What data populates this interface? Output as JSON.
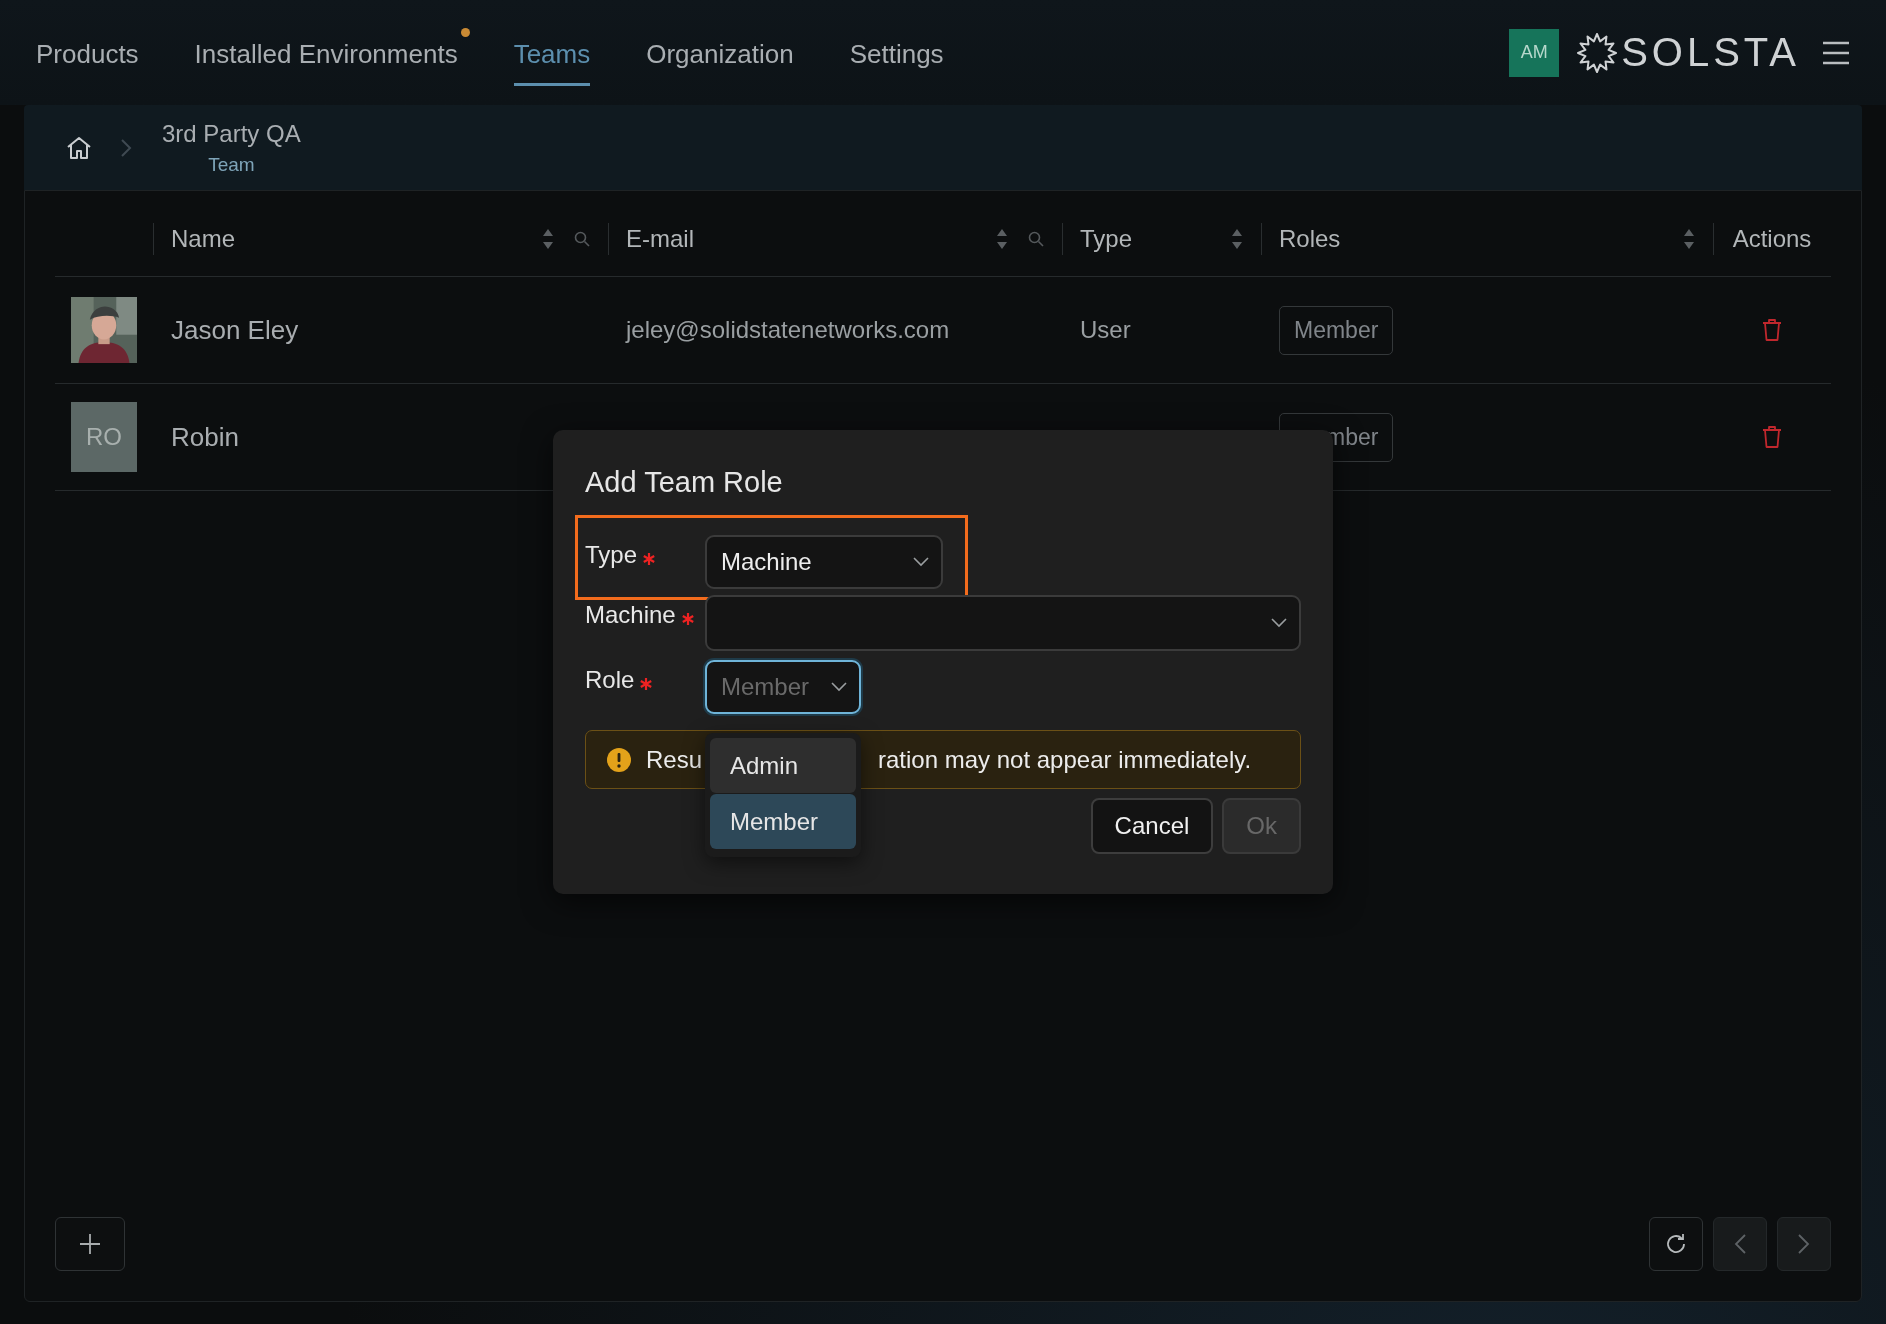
{
  "nav": {
    "tabs": [
      {
        "label": "Products",
        "selected": false,
        "badge": false
      },
      {
        "label": "Installed Environments",
        "selected": false,
        "badge": true
      },
      {
        "label": "Teams",
        "selected": true,
        "badge": false
      },
      {
        "label": "Organization",
        "selected": false,
        "badge": false
      },
      {
        "label": "Settings",
        "selected": false,
        "badge": false
      }
    ],
    "user_initials": "AM",
    "logo": "SOLSTA"
  },
  "breadcrumb": {
    "title": "3rd Party QA",
    "subtitle": "Team"
  },
  "table": {
    "columns": [
      {
        "label": "Name",
        "sortable": true,
        "searchable": true
      },
      {
        "label": "E-mail",
        "sortable": true,
        "searchable": true
      },
      {
        "label": "Type",
        "sortable": true,
        "searchable": false
      },
      {
        "label": "Roles",
        "sortable": true,
        "searchable": false
      },
      {
        "label": "Actions",
        "sortable": false,
        "searchable": false
      }
    ],
    "rows": [
      {
        "avatar": {
          "kind": "picture"
        },
        "name": "Jason Eley",
        "email": "jeley@solidstatenetworks.com",
        "type": "User",
        "roles": [
          "Member"
        ]
      },
      {
        "avatar": {
          "kind": "initials",
          "initials": "RO"
        },
        "name": "Robin",
        "roles": [
          "mber"
        ],
        "roles_cut": true
      }
    ]
  },
  "dialog": {
    "title": "Add Team Role",
    "fields": [
      {
        "kind": "compact",
        "label": "Type",
        "required": true,
        "value": "Machine",
        "highlighted": true,
        "focused": false
      },
      {
        "kind": "full",
        "label": "Machine",
        "required": true,
        "highlighted": false,
        "focused": false
      },
      {
        "kind": "compact",
        "label": "Role",
        "required": true,
        "value": "Member",
        "highlighted": false,
        "focused": true
      }
    ],
    "dropdown": {
      "options": [
        {
          "label": "Admin",
          "selected": false,
          "hovered": true
        },
        {
          "label": "Member",
          "selected": true,
          "hovered": false
        }
      ]
    },
    "alert": {
      "kind": "warning",
      "text_before": "Resu",
      "text_after": "ration may not appear immediately."
    },
    "buttons": [
      {
        "label": "Cancel",
        "disabled": false
      },
      {
        "label": "Ok",
        "disabled": true
      }
    ]
  },
  "footer": {
    "prev_disabled": true,
    "next_disabled": true
  }
}
